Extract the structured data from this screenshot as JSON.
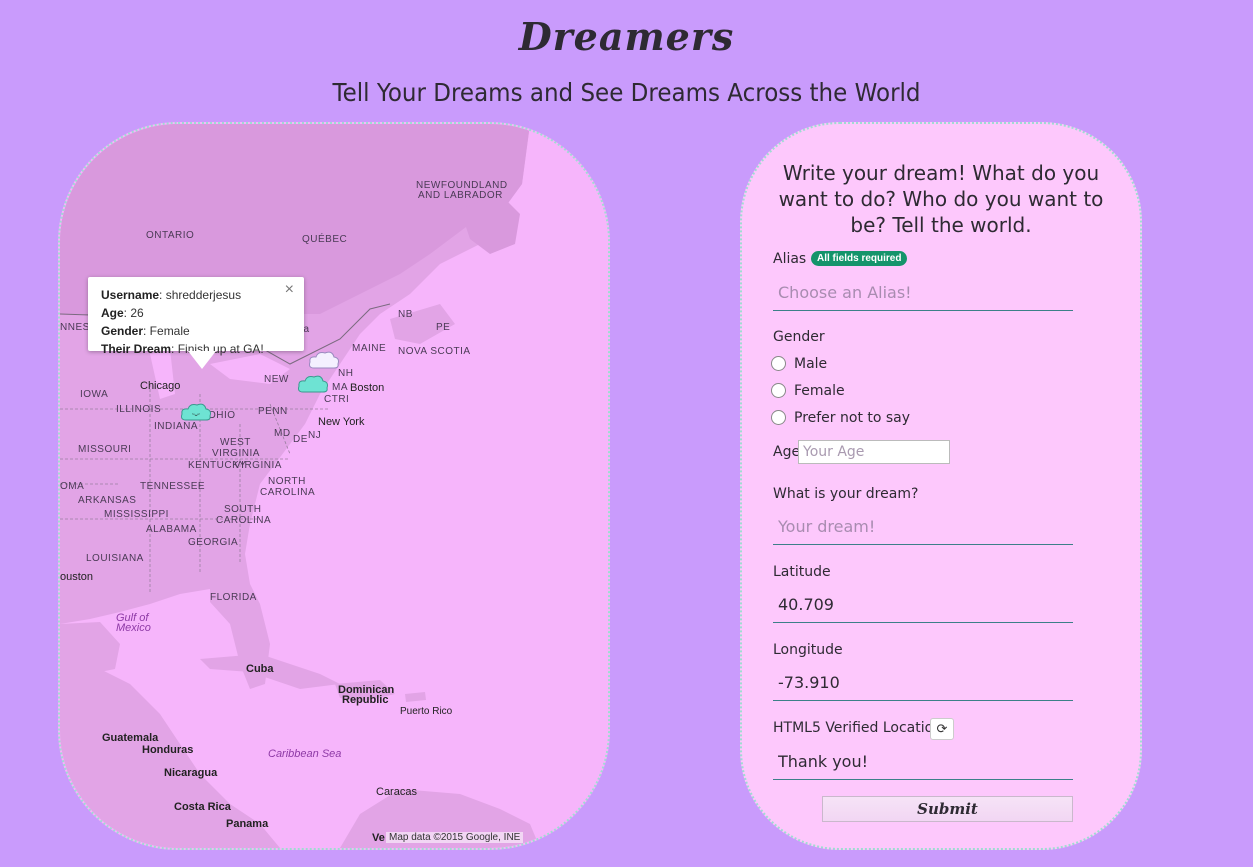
{
  "app": {
    "logo": "Dreamers",
    "subtitle": "Tell Your Dreams and See Dreams Across the World"
  },
  "map": {
    "labels": {
      "newfoundland": "NEWFOUNDLAND",
      "labrador": "AND LABRADOR",
      "ontario": "ONTARIO",
      "quebec": "QUÉBEC",
      "nb": "NB",
      "pe": "PE",
      "maine": "MAINE",
      "nova_scotia": "NOVA SCOTIA",
      "nh": "NH",
      "ma": "MA",
      "ct_ri": "CTRI",
      "boston": "Boston",
      "new_york": "New York",
      "iowa": "IOWA",
      "chicago": "Chicago",
      "illinois": "ILLINOIS",
      "indiana": "INDIANA",
      "ohio": "OHIO",
      "penn": "PENN",
      "md": "MD",
      "de": "DE",
      "nj": "NJ",
      "west": "WEST",
      "virginia_w": "VIRGINIA",
      "missouri": "MISSOURI",
      "kentucky": "KENTUCKY",
      "virginia": "VIRGINIA",
      "oma": "OMA",
      "tennessee": "TENNESSEE",
      "north": "NORTH",
      "carolina_n": "CAROLINA",
      "arkansas": "ARKANSAS",
      "mississippi": "MISSISSIPPI",
      "south": "SOUTH",
      "alabama": "ALABAMA",
      "carolina_s": "CAROLINA",
      "georgia": "GEORGIA",
      "louisiana": "LOUISIANA",
      "ouston": "ouston",
      "florida": "FLORIDA",
      "gulf1": "Gulf of",
      "gulf2": "Mexico",
      "cuba": "Cuba",
      "dominican": "Dominican",
      "republic": "Republic",
      "puerto_rico": "Puerto Rico",
      "guatemala": "Guatemala",
      "honduras": "Honduras",
      "caribbean": "Caribbean Sea",
      "nicaragua": "Nicaragua",
      "caracas": "Caracas",
      "costa_rica": "Costa Rica",
      "panama": "Panama",
      "nnes": "NNES",
      "va_partial": "va",
      "new_partial": "NEW",
      "ve": "Ve"
    },
    "attribution": "Map data ©2015 Google, INE",
    "infowindow": {
      "username_label": "Username",
      "username": ": shredderjesus",
      "age_label": "Age",
      "age": ": 26",
      "gender_label": "Gender",
      "gender": ": Female",
      "dream_label": "Their Dream",
      "dream": ": Finish up at GA!",
      "close": "×"
    }
  },
  "form": {
    "heading_line1": "Write your dream! What do you",
    "heading_line2": "want to do? Who do you want to",
    "heading_line3": "be? Tell the world.",
    "alias_label": "Alias",
    "badge": "All fields required",
    "alias_placeholder": "Choose an Alias!",
    "gender_label": "Gender",
    "gender_options": [
      "Male",
      "Female",
      "Prefer not to say"
    ],
    "age_label": "Age",
    "age_placeholder": "Your Age",
    "dream_label": "What is your dream?",
    "dream_placeholder": "Your dream!",
    "latitude_label": "Latitude",
    "latitude_value": "40.709",
    "longitude_label": "Longitude",
    "longitude_value": "-73.910",
    "html5_label": "HTML5 Verified Location?",
    "refresh_icon": "refresh-icon",
    "html5_value": "Thank you!",
    "submit_label": "Submit"
  },
  "colors": {
    "background": "#c99bfc",
    "map_water": "#f6b5fb",
    "form_bg": "#fdc8fc",
    "badge": "#14946b",
    "marker": "#6ee3d3"
  }
}
